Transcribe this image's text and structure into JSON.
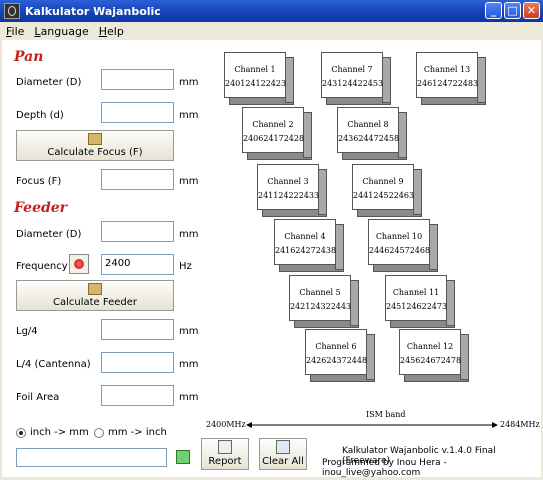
{
  "window": {
    "title": "Kalkulator Wajanbolic",
    "min": "_",
    "max": "□",
    "close": "✕"
  },
  "menu": [
    "File",
    "Language",
    "Help"
  ],
  "pan": {
    "title": "Pan",
    "diameter_label": "Diameter (D)",
    "diameter_value": "",
    "diameter_unit": "mm",
    "depth_label": "Depth (d)",
    "depth_value": "",
    "depth_unit": "mm",
    "calc_button": "Calculate Focus (F)",
    "focus_label": "Focus (F)",
    "focus_value": "",
    "focus_unit": "mm"
  },
  "feeder": {
    "title": "Feeder",
    "diameter_label": "Diameter (D)",
    "diameter_value": "",
    "diameter_unit": "mm",
    "frequency_label": "Frequency",
    "frequency_value": "2400",
    "frequency_unit": "Hz",
    "calc_button": "Calculate Feeder",
    "lg4_label": "Lg/4",
    "lg4_unit": "mm",
    "l4_label": "L/4 (Cantenna)",
    "l4_unit": "mm",
    "foil_label": "Foil Area",
    "foil_unit": "mm"
  },
  "conversion": {
    "opt1": "inch -> mm",
    "opt2": "mm -> inch",
    "selected": "inch -> mm"
  },
  "buttons": {
    "report": "Report",
    "clear": "Clear All"
  },
  "channels": [
    {
      "name": "Channel 1",
      "values": [
        "2401",
        "2412",
        "2423"
      ]
    },
    {
      "name": "Channel 2",
      "values": [
        "2406",
        "2417",
        "2428"
      ]
    },
    {
      "name": "Channel 3",
      "values": [
        "2411",
        "2422",
        "2433"
      ]
    },
    {
      "name": "Channel 4",
      "values": [
        "2416",
        "2427",
        "2438"
      ]
    },
    {
      "name": "Channel 5",
      "values": [
        "2421",
        "2432",
        "2443"
      ]
    },
    {
      "name": "Channel 6",
      "values": [
        "2426",
        "2437",
        "2448"
      ]
    },
    {
      "name": "Channel 7",
      "values": [
        "2431",
        "2442",
        "2453"
      ]
    },
    {
      "name": "Channel 8",
      "values": [
        "2436",
        "2447",
        "2458"
      ]
    },
    {
      "name": "Channel 9",
      "values": [
        "2441",
        "2452",
        "2463"
      ]
    },
    {
      "name": "Channel 10",
      "values": [
        "2446",
        "2457",
        "2468"
      ]
    },
    {
      "name": "Channel 11",
      "values": [
        "2451",
        "2462",
        "2473"
      ]
    },
    {
      "name": "Channel 12",
      "values": [
        "2456",
        "2467",
        "2478"
      ]
    },
    {
      "name": "Channel 13",
      "values": [
        "2461",
        "2472",
        "2483"
      ]
    }
  ],
  "band": {
    "start": "2400MHz",
    "label": "ISM band",
    "end": "2484MHz"
  },
  "footer": {
    "version": "Kalkulator Wajanbolic v.1.4.0 Final (Freeware)",
    "credit": "Programmed by Inou Hera - inou_live@yahoo.com"
  }
}
